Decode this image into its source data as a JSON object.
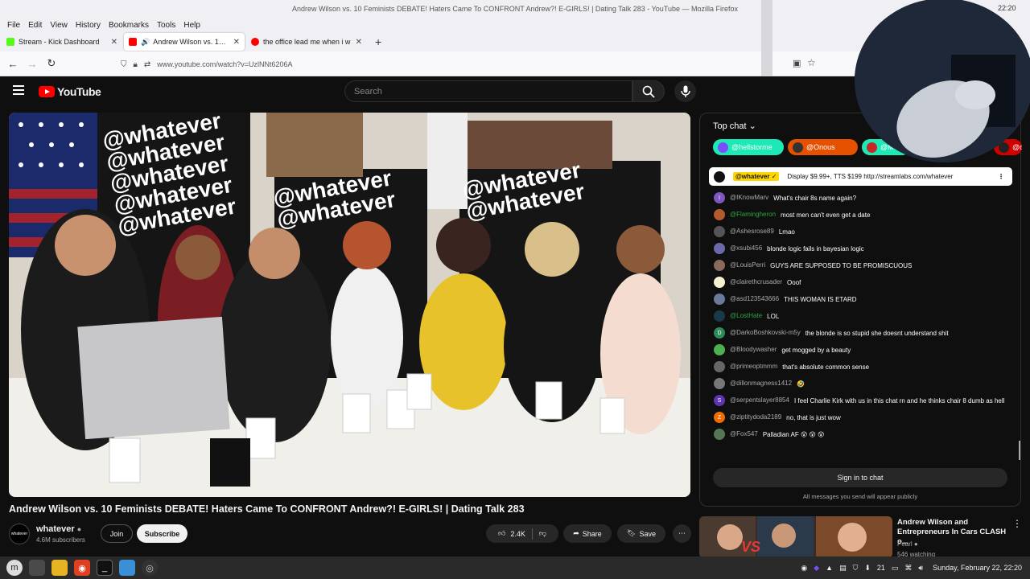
{
  "window": {
    "title": "Andrew Wilson vs. 10 Feminists DEBATE! Haters Came To CONFRONT Andrew?! E-GIRLS! | Dating Talk 283 - YouTube — Mozilla Firefox"
  },
  "menu": [
    "File",
    "Edit",
    "View",
    "History",
    "Bookmarks",
    "Tools",
    "Help"
  ],
  "tabs": [
    {
      "title": "Stream - Kick Dashboard",
      "color": "#53fc18"
    },
    {
      "title": "Andrew Wilson vs. 10 Fe",
      "color": "#ff0000"
    },
    {
      "title": "the office lead me when i w",
      "color": "#ff0000"
    }
  ],
  "url": "www.youtube.com/watch?v=UzlNNt6206A",
  "youtube": {
    "logo": "YouTube",
    "search_placeholder": "Search"
  },
  "video": {
    "title": "Andrew Wilson vs. 10 Feminists DEBATE! Haters Came To CONFRONT Andrew?! E-GIRLS! | Dating Talk 283",
    "channel": "whatever",
    "channel_avatar": "whatever",
    "subscribers": "4.6M subscribers",
    "join": "Join",
    "subscribe": "Subscribe",
    "likes": "2.4K",
    "share": "Share",
    "save": "Save",
    "backdrop_text": "@whatever"
  },
  "chat": {
    "header": "Top chat",
    "donors": [
      {
        "name": "@hellstorme",
        "color": "#1de9b6"
      },
      {
        "name": "@Onous",
        "color": "#e65100"
      },
      {
        "name": "@Meni",
        "color": "#1de9b6"
      },
      {
        "name": "@d",
        "color": "#d00000"
      }
    ],
    "pinned": {
      "user": "@whatever ✓",
      "text": "Display $9.99+, TTS $199 http://streamlabs.com/whatever"
    },
    "messages": [
      {
        "user": "@IKnowMarv",
        "text": "What's chair 8s name again?",
        "av": "I",
        "color": "#7e57c2",
        "green": false
      },
      {
        "user": "@Flamingheron",
        "text": "most men can't even get a date",
        "av": "",
        "color": "#b55a2c",
        "green": true
      },
      {
        "user": "@Ashesrose89",
        "text": "Lmao",
        "av": "",
        "color": "#555",
        "green": false
      },
      {
        "user": "@xsubi456",
        "text": "blonde logic fails in bayesian logic",
        "av": "",
        "color": "#6a6aaa",
        "green": false
      },
      {
        "user": "@LouisPerri",
        "text": "GUYS ARE SUPPOSED TO BE PROMISCUOUS",
        "av": "",
        "color": "#8a6a5a",
        "green": false
      },
      {
        "user": "@clairethcrusader",
        "text": "Ooof",
        "av": "",
        "color": "#f5f0d0",
        "green": false
      },
      {
        "user": "@asd123543666",
        "text": "THIS WOMAN IS ETARD",
        "av": "",
        "color": "#6a7a9a",
        "green": false
      },
      {
        "user": "@LostHate",
        "text": "LOL",
        "av": "",
        "color": "#1a3a4a",
        "green": true
      },
      {
        "user": "@DarkoBoshkovski-m5y",
        "text": "the blonde is so stupid she doesnt understand shit",
        "av": "D",
        "color": "#2e8b57",
        "green": false
      },
      {
        "user": "@Bloodywasher",
        "text": "get mogged by a beauty",
        "av": "",
        "color": "#4caf50",
        "green": false
      },
      {
        "user": "@primeoptmmm",
        "text": "that's absolute common sense",
        "av": "",
        "color": "#666",
        "green": false
      },
      {
        "user": "@dillonmagness1412",
        "text": "🤣",
        "av": "",
        "color": "#777",
        "green": false
      },
      {
        "user": "@serpentslayer8854",
        "text": "I feel Charlie Kirk with us in this chat rn and he thinks chair 8 dumb as hell",
        "av": "S",
        "color": "#5e35b1",
        "green": false
      },
      {
        "user": "@ziptitydoda2189",
        "text": "no, that is just wow",
        "av": "Z",
        "color": "#ef6c00",
        "green": false
      },
      {
        "user": "@Fox547",
        "text": "Palladian AF 😲 😲 😲",
        "av": "",
        "color": "#557755",
        "green": false
      }
    ],
    "sign_in": "Sign in to chat",
    "note": "All messages you send will appear publicly"
  },
  "recommended": {
    "title": "Andrew Wilson and Entrepreneurs In Cars CLASH o...",
    "channel": "Pearl",
    "watching": "546 watching",
    "thumb_text": "VS"
  },
  "taskbar": {
    "tray_count": "21",
    "datetime": "Sunday, February 22, 22:20",
    "clock_top": "22:20"
  }
}
